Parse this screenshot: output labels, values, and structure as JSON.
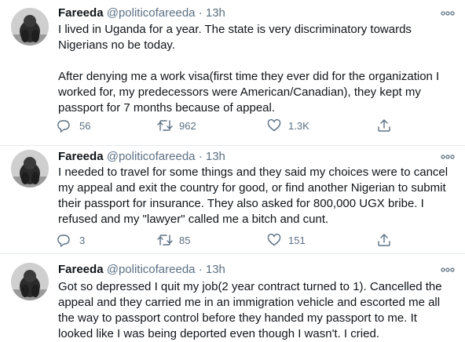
{
  "tweets": [
    {
      "name": "Fareeda",
      "handle": "@politicofareeda",
      "separator": "·",
      "time": "13h",
      "paragraphs": [
        "I lived in Uganda for a year. The state is very discriminatory towards Nigerians no be today.",
        "After denying me a work visa(first time they ever did for the organization I worked for, my predecessors were American/Canadian), they kept my passport for 7 months because of appeal."
      ],
      "replies": "56",
      "retweets": "962",
      "likes": "1.3K"
    },
    {
      "name": "Fareeda",
      "handle": "@politicofareeda",
      "separator": "·",
      "time": "13h",
      "paragraphs": [
        "I needed to travel for some things and they said my choices were to cancel my appeal and exit the country for good, or find another Nigerian to submit their passport for insurance. They also asked for 800,000 UGX bribe. I refused and my \"lawyer\" called me a bitch and cunt."
      ],
      "replies": "3",
      "retweets": "85",
      "likes": "151"
    },
    {
      "name": "Fareeda",
      "handle": "@politicofareeda",
      "separator": "·",
      "time": "13h",
      "paragraphs": [
        "Got so depressed I quit my job(2 year contract turned to 1). Cancelled the appeal and they carried me in an immigration vehicle and escorted me all the way to passport control before they handed my passport to me. It looked like I was being deported even though I wasn't. I cried."
      ],
      "replies": "",
      "retweets": "",
      "likes": ""
    }
  ],
  "icons": {
    "more": "more-horizontal-icon",
    "reply": "reply-icon",
    "retweet": "retweet-icon",
    "like": "heart-icon",
    "share": "share-icon"
  },
  "colors": {
    "text": "#0f1419",
    "secondary": "#5b7083",
    "divider": "#e6ecf0"
  }
}
